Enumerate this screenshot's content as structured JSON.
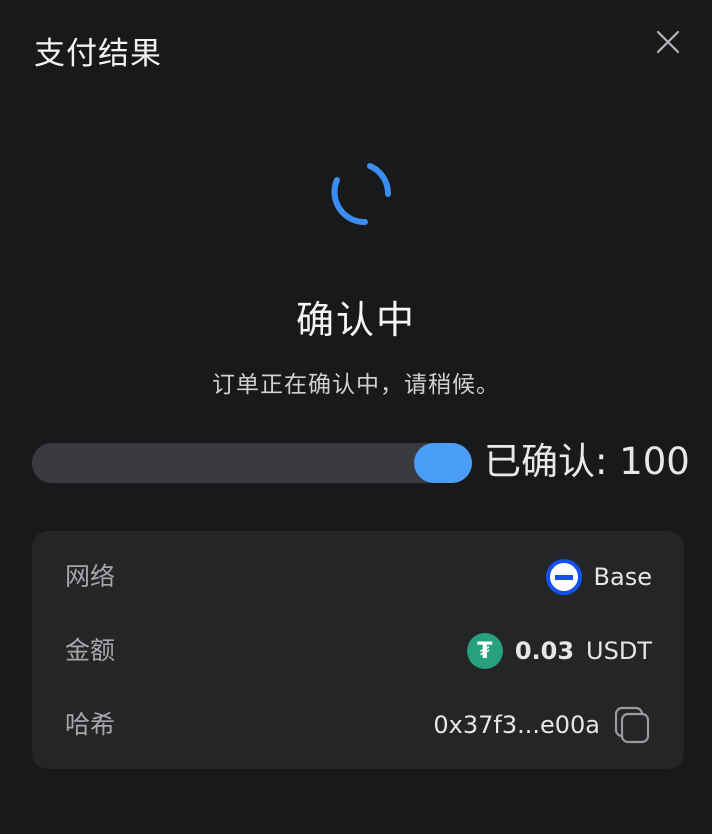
{
  "modal": {
    "title": "支付结果"
  },
  "status": {
    "title": "确认中",
    "description": "订单正在确认中，请稍候。"
  },
  "progress": {
    "label": "已确认: 100",
    "value_percent": 100
  },
  "details": {
    "network": {
      "label": "网络",
      "value": "Base",
      "icon": "base-network-icon"
    },
    "amount": {
      "label": "金额",
      "value": "0.03",
      "unit": "USDT",
      "icon": "usdt-icon"
    },
    "hash": {
      "label": "哈希",
      "value": "0x37f3...e00a",
      "icon": "copy-icon"
    }
  },
  "colors": {
    "background": "#18191b",
    "panel": "#242527",
    "accent": "#4a9ef8",
    "track": "#3a3b3e",
    "base_brand": "#1450f0",
    "usdt_brand": "#26a17b"
  }
}
